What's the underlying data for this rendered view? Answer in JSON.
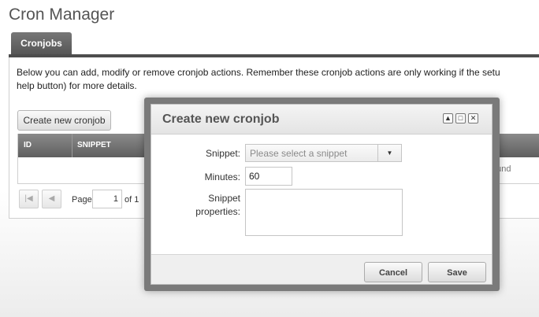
{
  "app": {
    "title": "Cron Manager"
  },
  "tabs": [
    {
      "label": "Cronjobs"
    }
  ],
  "description": "Below you can add, modify or remove cronjob actions. Remember these cronjob actions are only working if the setup is correct (see the help button) for more details.",
  "description_line2": "help button) for more details.",
  "toolbar": {
    "create_label": "Create new cronjob"
  },
  "grid": {
    "columns": [
      "ID",
      "SNIPPET"
    ],
    "empty_text": "found"
  },
  "pager": {
    "page_label": "Page",
    "current_page": "1",
    "of_label": "of 1"
  },
  "modal": {
    "title": "Create new cronjob",
    "fields": {
      "snippet_label": "Snippet:",
      "snippet_placeholder": "Please select a snippet",
      "minutes_label": "Minutes:",
      "minutes_value": "60",
      "properties_label_1": "Snippet",
      "properties_label_2": "properties:"
    },
    "cancel_label": "Cancel",
    "save_label": "Save"
  },
  "icons": {
    "first": "first-page-icon",
    "prev": "prev-page-icon",
    "collapse": "collapse-icon",
    "maximize": "maximize-icon",
    "close": "close-icon",
    "dropdown": "chevron-down-icon"
  },
  "colors": {
    "tab_bg": "#555555",
    "grid_header": "#6a6a6a",
    "modal_frame": "#7a7a7a"
  }
}
